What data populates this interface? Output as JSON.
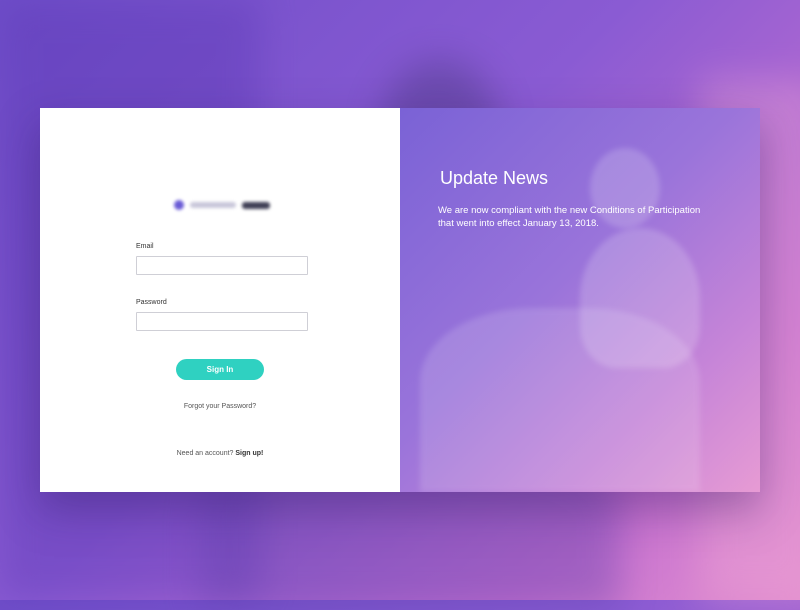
{
  "login": {
    "email_label": "Email",
    "email_value": "",
    "password_label": "Password",
    "password_value": "",
    "signin_label": "Sign In",
    "forgot_label": "Forgot your Password?",
    "need_account_text": "Need an account?",
    "signup_label": "Sign up!"
  },
  "news": {
    "title": "Update News",
    "body": "We are now compliant with the new Conditions of Participation that went into  effect January 13, 2018."
  },
  "colors": {
    "accent": "#2fd1c1",
    "gradient_start": "#7a62d6",
    "gradient_end": "#e79bd4"
  }
}
